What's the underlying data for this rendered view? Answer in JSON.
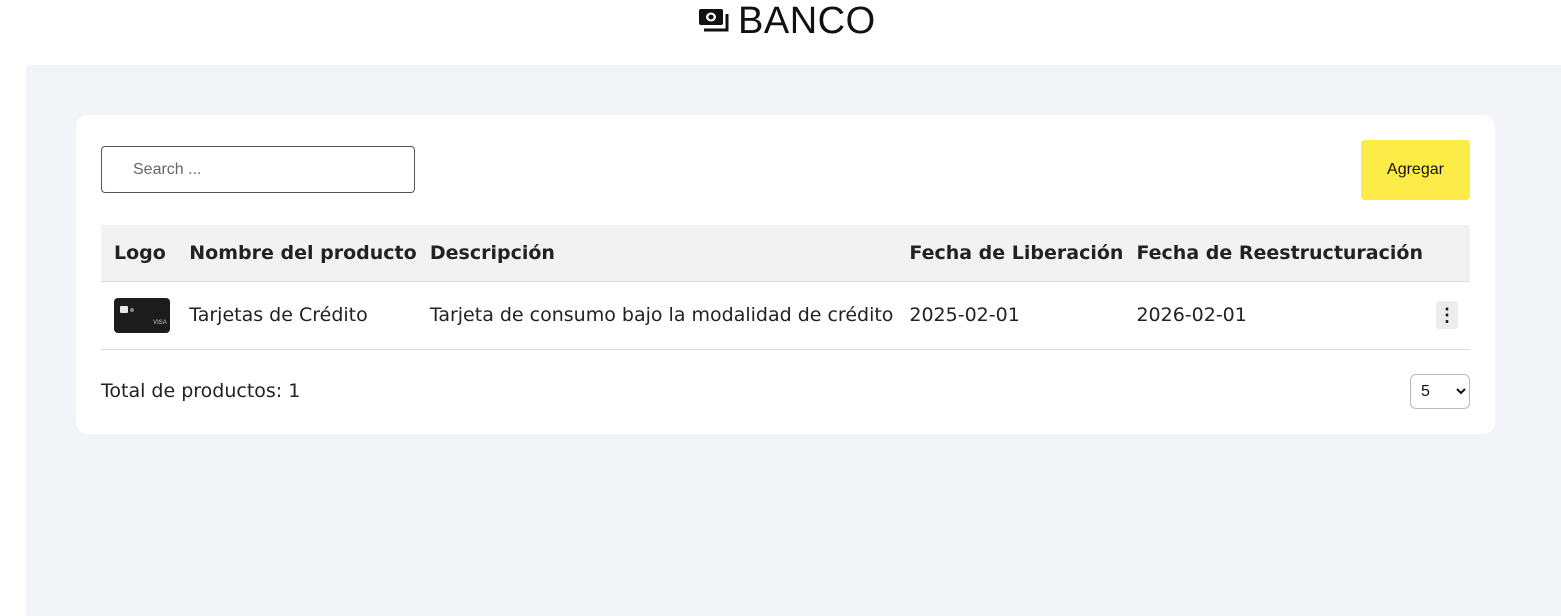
{
  "header": {
    "title": "BANCO",
    "icon": "money-bill-icon"
  },
  "search": {
    "placeholder": "Search ...",
    "value": ""
  },
  "actions": {
    "add_label": "Agregar",
    "add_color": "#fdec47"
  },
  "table": {
    "columns": [
      "Logo",
      "Nombre del producto",
      "Descripción",
      "Fecha de Liberación",
      "Fecha de Reestructuración"
    ],
    "rows": [
      {
        "logo": "credit-card-image",
        "logo_text": "VISA",
        "name": "Tarjetas de Crédito",
        "description": "Tarjeta de consumo bajo la modalidad de crédito",
        "release_date": "2025-02-01",
        "restructure_date": "2026-02-01",
        "menu_icon": "⋮"
      }
    ]
  },
  "footer": {
    "total_label": "Total de productos: 1",
    "page_size": "5",
    "page_size_options": [
      "5"
    ]
  }
}
